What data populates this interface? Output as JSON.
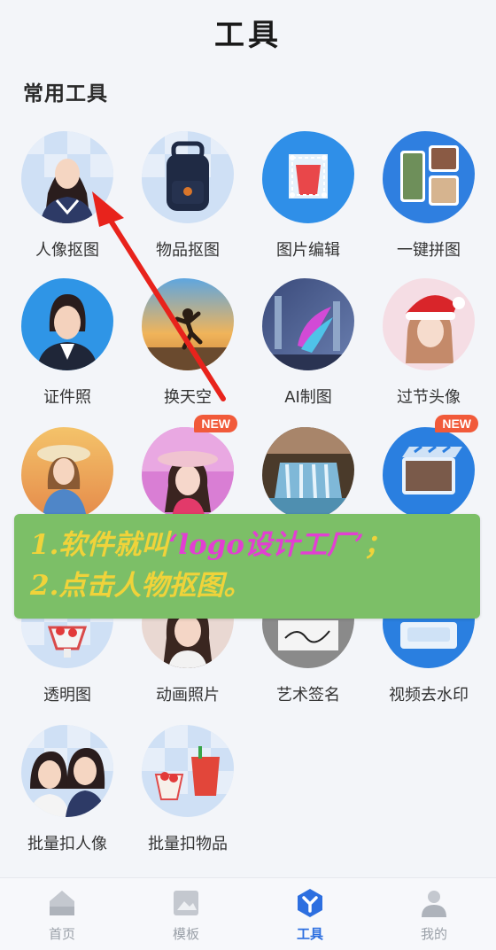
{
  "header": {
    "title": "工具"
  },
  "section": {
    "title": "常用工具"
  },
  "tools": [
    {
      "label": "人像抠图",
      "icon": "portrait-cutout-icon"
    },
    {
      "label": "物品抠图",
      "icon": "object-cutout-icon"
    },
    {
      "label": "图片编辑",
      "icon": "image-edit-icon"
    },
    {
      "label": "一键拼图",
      "icon": "collage-icon"
    },
    {
      "label": "证件照",
      "icon": "id-photo-icon"
    },
    {
      "label": "换天空",
      "icon": "sky-replace-icon"
    },
    {
      "label": "AI制图",
      "icon": "ai-draw-icon"
    },
    {
      "label": "过节头像",
      "icon": "holiday-avatar-icon"
    },
    {
      "label": "",
      "icon": "beach-portrait-icon"
    },
    {
      "label": "",
      "icon": "hat-portrait-icon",
      "badge": "NEW"
    },
    {
      "label": "",
      "icon": "waterfall-icon"
    },
    {
      "label": "",
      "icon": "video-icon",
      "badge": "NEW"
    },
    {
      "label": "透明图",
      "icon": "transparent-image-icon"
    },
    {
      "label": "动画照片",
      "icon": "animated-photo-icon"
    },
    {
      "label": "艺术签名",
      "icon": "art-signature-icon"
    },
    {
      "label": "视频去水印",
      "icon": "video-watermark-remove-icon"
    },
    {
      "label": "批量扣人像",
      "icon": "batch-portrait-icon"
    },
    {
      "label": "批量扣物品",
      "icon": "batch-object-icon"
    }
  ],
  "overlay": {
    "line1_num": "1.",
    "line1_text": "软件就叫",
    "line1_name": "‘logo设计工厂’",
    "line1_end": "；",
    "line2": "2.点击人物抠图。"
  },
  "tabbar": [
    {
      "label": "首页",
      "icon": "home-icon",
      "active": false
    },
    {
      "label": "模板",
      "icon": "template-icon",
      "active": false
    },
    {
      "label": "工具",
      "icon": "tools-icon",
      "active": true
    },
    {
      "label": "我的",
      "icon": "profile-icon",
      "active": false
    }
  ],
  "colors": {
    "accent": "#2d6fe0",
    "badge": "#f15a3a",
    "overlay_bg": "#7cbf67",
    "arrow": "#e8231c"
  }
}
